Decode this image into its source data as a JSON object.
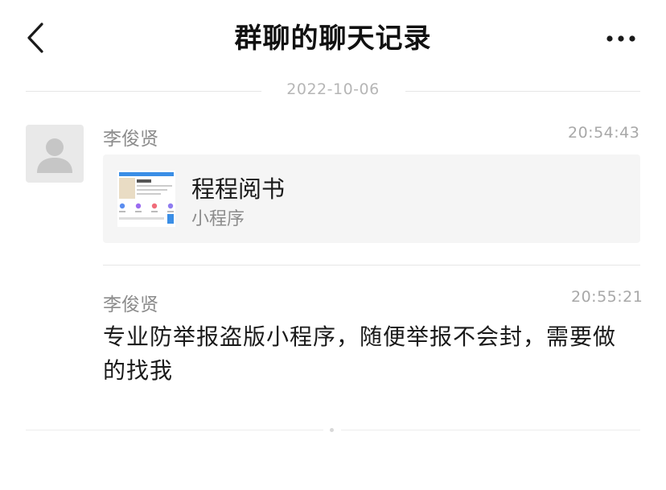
{
  "header": {
    "title": "群聊的聊天记录",
    "back_icon": "chevron-left-icon",
    "more_icon": "more-dots-icon"
  },
  "date_separator": "2022-10-06",
  "messages": [
    {
      "sender": "李俊贤",
      "time": "20:54:43",
      "mini_program": {
        "title": "程程阅书",
        "subtitle": "小程序"
      }
    },
    {
      "sender": "李俊贤",
      "time": "20:55:21",
      "text": "专业防举报盗版小程序，随便举报不会封，需要做的找我"
    }
  ],
  "colors": {
    "background": "#ffffff",
    "card_background": "#f5f5f5",
    "muted_text": "#8c8c8c",
    "divider": "#e6e6e6"
  }
}
